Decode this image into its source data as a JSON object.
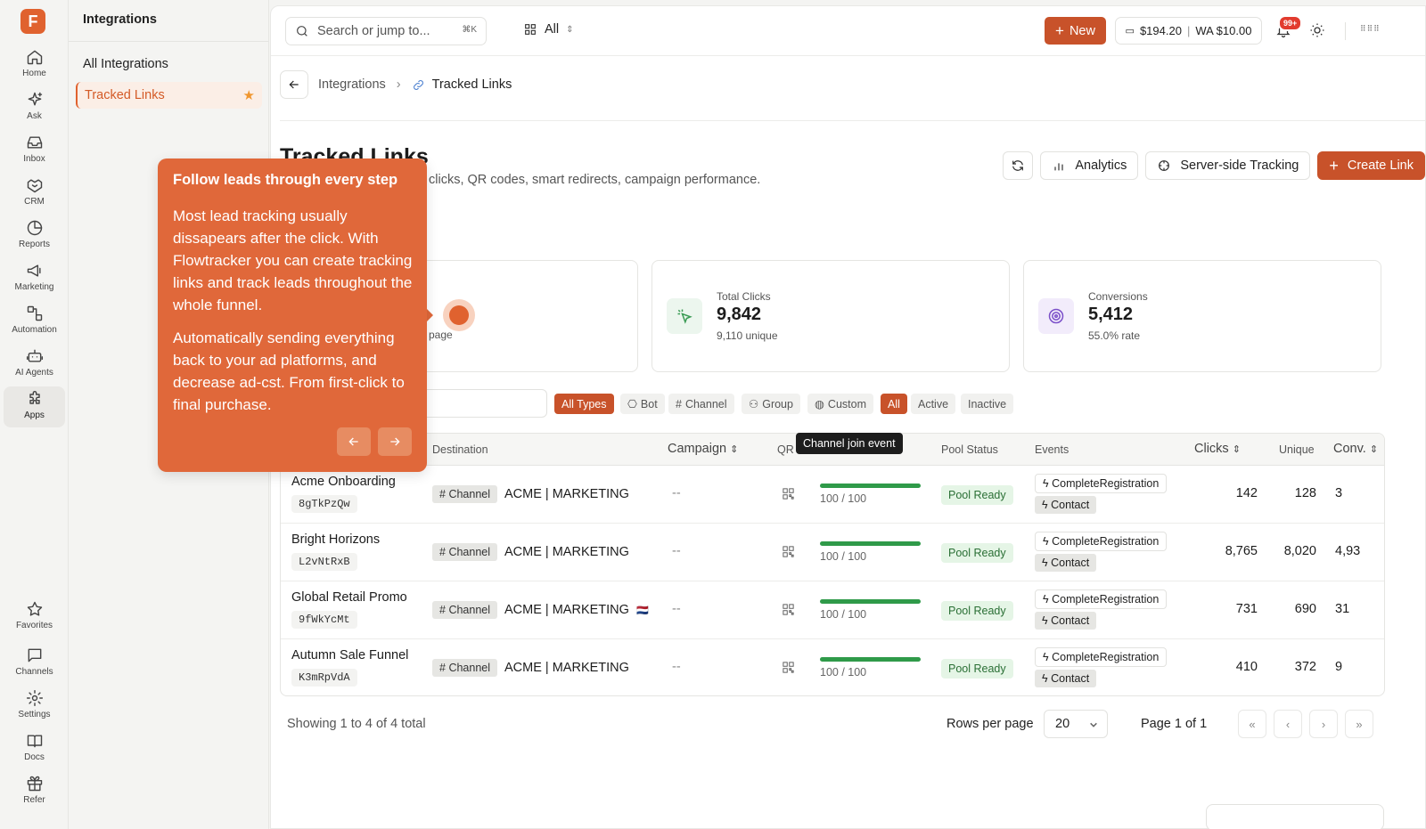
{
  "rail": {
    "items": [
      {
        "label": "Home",
        "icon": "home-icon"
      },
      {
        "label": "Ask",
        "icon": "sparkle-icon"
      },
      {
        "label": "Inbox",
        "icon": "inbox-icon"
      },
      {
        "label": "CRM",
        "icon": "handshake-icon"
      },
      {
        "label": "Reports",
        "icon": "pie-chart-icon"
      },
      {
        "label": "Marketing",
        "icon": "megaphone-icon"
      },
      {
        "label": "Automation",
        "icon": "workflow-icon"
      },
      {
        "label": "AI Agents",
        "icon": "robot-icon"
      },
      {
        "label": "Apps",
        "icon": "puzzle-icon"
      }
    ],
    "bottom": [
      {
        "label": "Favorites",
        "icon": "star-icon"
      },
      {
        "label": "Channels",
        "icon": "chat-icon"
      },
      {
        "label": "Settings",
        "icon": "gear-icon"
      },
      {
        "label": "Docs",
        "icon": "book-icon"
      },
      {
        "label": "Refer",
        "icon": "gift-icon"
      }
    ],
    "active": "Apps"
  },
  "subnav": {
    "title": "Integrations",
    "items": [
      "All Integrations",
      "Tracked Links"
    ]
  },
  "topbar": {
    "search_placeholder": "Search or jump to...",
    "shortcut": "⌘K",
    "scope": "All",
    "new_label": "New",
    "balance": "$194.20",
    "wa_balance": "WA $10.00",
    "notif_count": "99+"
  },
  "breadcrumb": {
    "parent": "Integrations",
    "current": "Tracked Links"
  },
  "page": {
    "title": "Tracked Links",
    "subtitle": "clicks, QR codes, smart redirects, campaign performance.",
    "actions": [
      "Analytics",
      "Server-side Tracking",
      "Create Link"
    ]
  },
  "stats": [
    {
      "label": "Total Clicks",
      "value": "9,842",
      "sub": "9,110 unique",
      "icon": "cursor-click-icon",
      "color": "#3a9b54"
    },
    {
      "label": "Conversions",
      "value": "5,412",
      "sub": "55.0% rate",
      "icon": "target-icon",
      "color": "#7b4fc9"
    }
  ],
  "under_tour_text": "page",
  "filters": {
    "types": [
      "All Types",
      "Bot",
      "Channel",
      "Group",
      "Custom"
    ],
    "status": [
      "All",
      "Active",
      "Inactive"
    ]
  },
  "table": {
    "headers": [
      "Destination",
      "Campaign",
      "QR",
      "Pool Status",
      "Events",
      "Clicks",
      "Unique",
      "Conv."
    ],
    "tooltip": "Channel join event",
    "rows": [
      {
        "name": "Acme Onboarding",
        "code": "8gTkPzQw",
        "dest_type": "Channel",
        "dest": "ACME | MARKETING",
        "flag": "",
        "campaign": "--",
        "pool": "100 / 100",
        "pool_status": "Pool Ready",
        "event1": "CompleteRegistration",
        "event2": "Contact",
        "clicks": "142",
        "unique": "128",
        "conv": "3"
      },
      {
        "name": "Bright Horizons",
        "code": "L2vNtRxB",
        "dest_type": "Channel",
        "dest": "ACME | MARKETING",
        "flag": "",
        "campaign": "--",
        "pool": "100 / 100",
        "pool_status": "Pool Ready",
        "event1": "CompleteRegistration",
        "event2": "Contact",
        "clicks": "8,765",
        "unique": "8,020",
        "conv": "4,93"
      },
      {
        "name": "Global Retail Promo",
        "code": "9fWkYcMt",
        "dest_type": "Channel",
        "dest": "ACME | MARKETING",
        "flag": "🇳🇱",
        "campaign": "--",
        "pool": "100 / 100",
        "pool_status": "Pool Ready",
        "event1": "CompleteRegistration",
        "event2": "Contact",
        "clicks": "731",
        "unique": "690",
        "conv": "31"
      },
      {
        "name": "Autumn Sale Funnel",
        "code": "K3mRpVdA",
        "dest_type": "Channel",
        "dest": "ACME | MARKETING",
        "flag": "",
        "campaign": "--",
        "pool": "100 / 100",
        "pool_status": "Pool Ready",
        "event1": "CompleteRegistration",
        "event2": "Contact",
        "clicks": "410",
        "unique": "372",
        "conv": "9"
      }
    ]
  },
  "footer": {
    "showing": "Showing 1 to 4 of 4 total",
    "rows_per_page_label": "Rows per page",
    "rows_per_page": "20",
    "page": "Page 1 of 1"
  },
  "tour": {
    "title": "Follow leads through every step",
    "p1": "Most lead tracking usually dissapears after the click. With Flowtracker you can create tracking links and track leads throughout the whole funnel.",
    "p2": "Automatically sending everything back to your ad platforms, and decrease ad-cst. From first-click to final purchase."
  }
}
